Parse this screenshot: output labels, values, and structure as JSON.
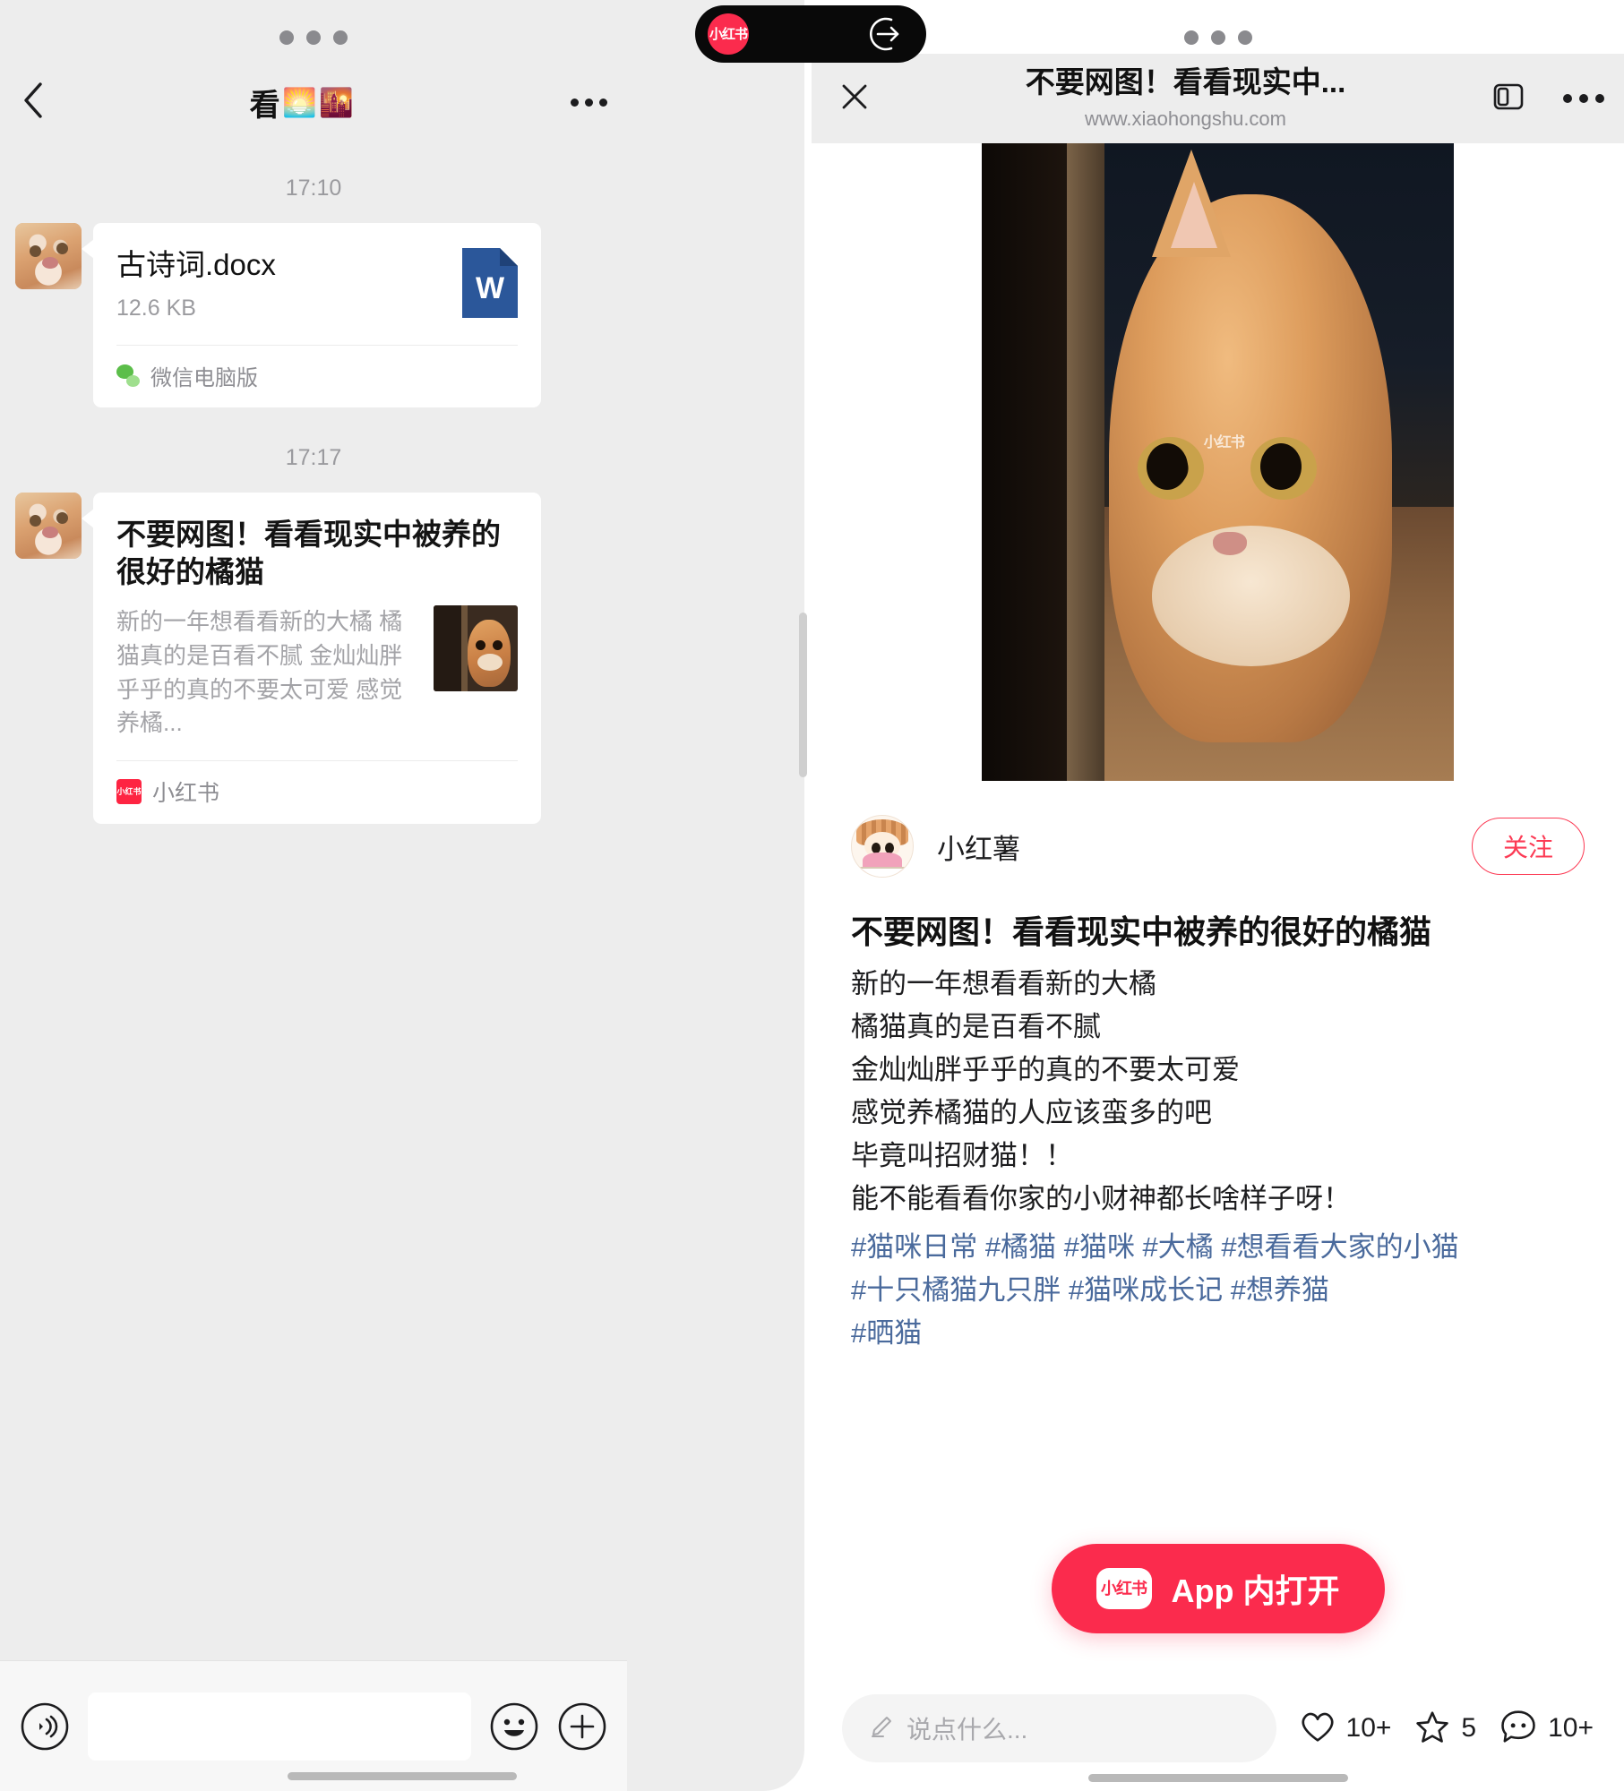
{
  "left_panel": {
    "header": {
      "back_icon": "chevron-left-icon",
      "title": "看",
      "emoji1": "🌅",
      "emoji2": "🌇",
      "more_icon": "more-horizontal-icon"
    },
    "messages": [
      {
        "timestamp": "17:10",
        "type": "file",
        "file_name": "古诗词.docx",
        "file_size": "12.6 KB",
        "file_icon": "word-document-icon",
        "file_icon_letter": "W",
        "source_icon": "wechat-icon",
        "source": "微信电脑版"
      },
      {
        "timestamp": "17:17",
        "type": "link",
        "title": "不要网图！看看现实中被养的很好的橘猫",
        "description": "新的一年想看看新的大橘 橘猫真的是百看不腻 金灿灿胖乎乎的真的不要太可爱 感觉养橘...",
        "thumbnail": "orange-cat-thumbnail",
        "source_icon": "xiaohongshu-icon",
        "source": "小红书"
      }
    ],
    "input_bar": {
      "voice_icon": "voice-input-icon",
      "input_value": "",
      "emoji_icon": "emoji-smiley-icon",
      "plus_icon": "plus-circle-icon"
    }
  },
  "dynamic_island": {
    "app_logo_text": "小红书",
    "action_icon": "arrow-into-circle-icon"
  },
  "right_panel": {
    "header": {
      "close_icon": "close-x-icon",
      "title": "不要网图！看看现实中...",
      "url": "www.xiaohongshu.com",
      "sidebar_icon": "panel-layout-icon",
      "more_icon": "more-horizontal-icon"
    },
    "hero_image": "orange-cat-peeking-behind-door",
    "hero_watermark": "小红书",
    "author": {
      "avatar": "cartoon-girl-avatar",
      "name": "小红薯",
      "follow_label": "关注"
    },
    "post": {
      "title": "不要网图！看看现实中被养的很好的橘猫",
      "lines": [
        "新的一年想看看新的大橘",
        "橘猫真的是百看不腻",
        "金灿灿胖乎乎的真的不要太可爱",
        "感觉养橘猫的人应该蛮多的吧",
        "毕竟叫招财猫！！",
        "能不能看看你家的小财神都长啥样子呀！"
      ],
      "tag_lines": [
        "#猫咪日常 #橘猫 #猫咪 #大橘 #想看看大家的小猫",
        "#十只橘猫九只胖 #猫咪成长记 #想养猫",
        "#晒猫"
      ]
    },
    "app_open_button": {
      "logo_text": "小红书",
      "label": "App 内打开"
    },
    "footer": {
      "comment_icon": "pencil-icon",
      "comment_placeholder": "说点什么...",
      "like_icon": "heart-icon",
      "like_count": "10+",
      "star_icon": "star-icon",
      "star_count": "5",
      "reply_icon": "comment-bubble-icon",
      "reply_count": "10+"
    }
  },
  "colors": {
    "accent_red": "#fb2b4d",
    "word_blue": "#2b579a",
    "wechat_green": "#5cbe4a",
    "chat_bg": "#ededed"
  }
}
